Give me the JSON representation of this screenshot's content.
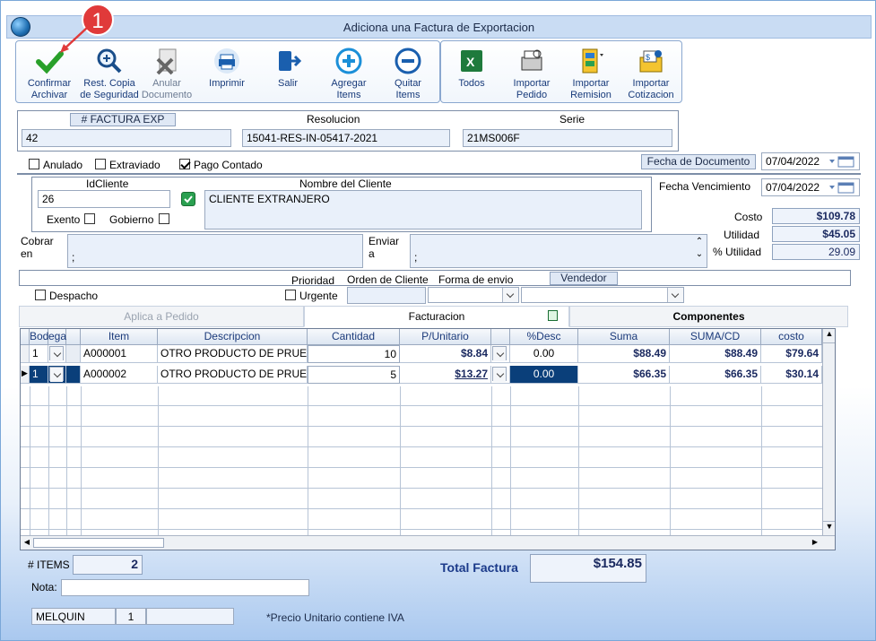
{
  "window": {
    "title": "Adiciona una Factura de Exportacion"
  },
  "annotation": {
    "badge": "1"
  },
  "toolbar": {
    "confirmar": "Confirmar\nArchivar",
    "rest": "Rest. Copia\nde Seguridad",
    "anular": "Anular\nDocumento",
    "imprimir": "Imprimir",
    "salir": "Salir",
    "agregar": "Agregar\nItems",
    "quitar": "Quitar\nItems",
    "todos": "Todos",
    "importar_pedido": "Importar\nPedido",
    "importar_remision": "Importar\nRemision",
    "importar_cotizacion": "Importar\nCotizacion"
  },
  "header": {
    "factura_label": "# FACTURA EXP",
    "factura_value": "42",
    "resolucion_label": "Resolucion",
    "resolucion_value": "15041-RES-IN-05417-2021",
    "serie_label": "Serie",
    "serie_value": "21MS006F"
  },
  "flags": {
    "anulado": "Anulado",
    "extraviado": "Extraviado",
    "pago_contado": "Pago Contado"
  },
  "fechas": {
    "documento_label": "Fecha de Documento",
    "documento_value": "07/04/2022",
    "vencimiento_label": "Fecha Vencimiento",
    "vencimiento_value": "07/04/2022"
  },
  "cliente": {
    "id_label": "IdCliente",
    "id_value": "26",
    "nombre_label": "Nombre del Cliente",
    "nombre_value": "CLIENTE EXTRANJERO",
    "exento": "Exento",
    "gobierno": "Gobierno"
  },
  "totals_side": {
    "costo_label": "Costo",
    "costo_value": "$109.78",
    "utilidad_label": "Utilidad",
    "utilidad_value": "$45.05",
    "putilidad_label": "% Utilidad",
    "putilidad_value": "29.09"
  },
  "cobrar": {
    "label1": "Cobrar",
    "label2": "en",
    "value": ";"
  },
  "enviar": {
    "label1": "Enviar",
    "label2": "a",
    "value": ";"
  },
  "options": {
    "prioridad": "Prioridad",
    "orden": "Orden de Cliente",
    "forma": "Forma de envio",
    "vendedor": "Vendedor",
    "despacho": "Despacho",
    "urgente": "Urgente"
  },
  "tabs": {
    "aplica": "Aplica a Pedido",
    "facturacion": "Facturacion",
    "componentes": "Componentes"
  },
  "grid": {
    "headers": [
      "Bod",
      "ega",
      "Item",
      "Descripcion",
      "Cantidad",
      "P/Unitario",
      "%Desc",
      "Suma",
      "SUMA/CD",
      "costo"
    ],
    "rows": [
      {
        "bod": "1",
        "item": "A000001",
        "desc": "OTRO PRODUCTO DE PRUE",
        "cant": "10",
        "punit": "$8.84",
        "desc_pct": "0.00",
        "suma": "$88.49",
        "sumacd": "$88.49",
        "costo": "$79.64"
      },
      {
        "bod": "1",
        "item": "A000002",
        "desc": "OTRO PRODUCTO DE PRUE",
        "cant": "5",
        "punit": "$13.27",
        "desc_pct": "0.00",
        "suma": "$66.35",
        "sumacd": "$66.35",
        "costo": "$30.14"
      }
    ]
  },
  "footer": {
    "items_label": "# ITEMS",
    "items_value": "2",
    "total_label": "Total Factura",
    "total_value": "$154.85",
    "nota_label": "Nota:",
    "user": "MELQUIN",
    "user_num": "1",
    "note": "*Precio Unitario contiene IVA"
  },
  "colors": {
    "accent": "#0a3f7a",
    "title_bg": "#c9dcf3",
    "badge": "#e03a3a"
  }
}
